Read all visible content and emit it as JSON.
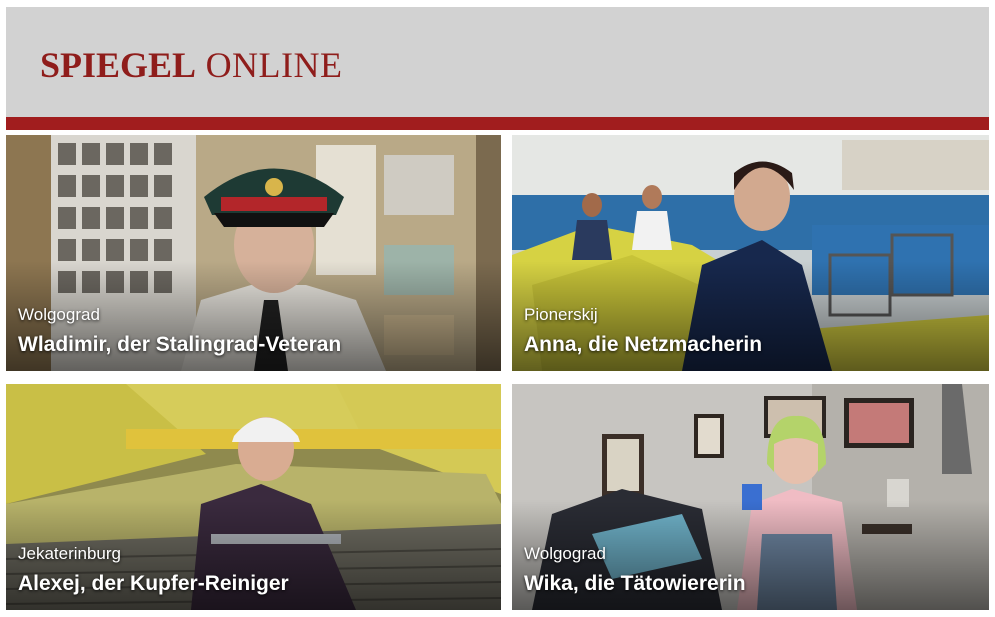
{
  "header": {
    "logo_bold": "SPIEGEL",
    "logo_light": "ONLINE",
    "brand_color": "#a11d1e"
  },
  "tiles": [
    {
      "place": "Wolgograd",
      "name": "Wladimir, der Stalingrad-Veteran"
    },
    {
      "place": "Pionerskij",
      "name": "Anna, die Netzmacherin"
    },
    {
      "place": "Jekaterinburg",
      "name": "Alexej, der Kupfer-Reiniger"
    },
    {
      "place": "Wolgograd",
      "name": "Wika, die Tätowiererin"
    }
  ]
}
